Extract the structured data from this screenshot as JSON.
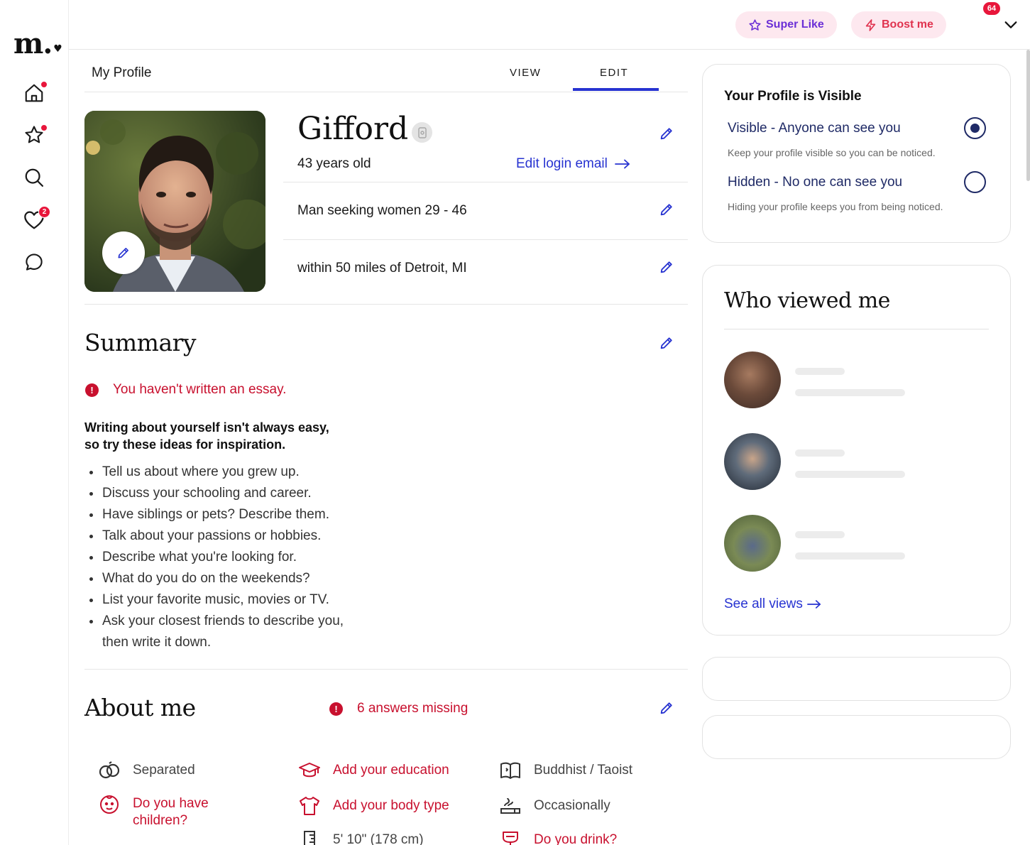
{
  "brand": {
    "logo_text": "m.",
    "logo_heart": "♥"
  },
  "sidebar": {
    "items": [
      {
        "name": "home",
        "icon": "home-icon",
        "dot": true
      },
      {
        "name": "favorites",
        "icon": "star-icon",
        "dot": true
      },
      {
        "name": "search",
        "icon": "search-icon"
      },
      {
        "name": "likes",
        "icon": "heart-icon",
        "badge": "2"
      },
      {
        "name": "messages",
        "icon": "chat-bubble-icon"
      }
    ]
  },
  "topbar": {
    "super_like_label": "Super Like",
    "boost_label": "Boost me",
    "notification_count": "64"
  },
  "profile_header": {
    "title": "My Profile",
    "tabs": [
      {
        "label": "VIEW"
      },
      {
        "label": "EDIT",
        "active": true
      }
    ]
  },
  "profile": {
    "name": "Gifford",
    "age_text": "43 years old",
    "edit_login_email": "Edit login email",
    "seeking": "Man seeking women 29 - 46",
    "location": "within 50 miles of Detroit, MI"
  },
  "summary": {
    "title": "Summary",
    "warning": "You haven't written an essay.",
    "ideas_heading_line1": "Writing about yourself isn't always easy,",
    "ideas_heading_line2": "so try these ideas for inspiration.",
    "ideas": [
      "Tell us about where you grew up.",
      "Discuss your schooling and career.",
      "Have siblings or pets? Describe them.",
      "Talk about your passions or hobbies.",
      "Describe what you're looking for.",
      "What do you do on the weekends?",
      "List your favorite music, movies or TV.",
      "Ask your closest friends to describe you, then write it down."
    ]
  },
  "about": {
    "title": "About me",
    "missing": "6 answers missing",
    "items": [
      {
        "text": "Separated",
        "icon": "rings-icon",
        "missing": false
      },
      {
        "text": "Add your education",
        "icon": "graduation-cap-icon",
        "missing": true
      },
      {
        "text": "Buddhist / Taoist",
        "icon": "book-icon",
        "missing": false
      },
      {
        "text": "Do you have children?",
        "icon": "child-face-icon",
        "missing": true
      },
      {
        "text": "Add your body type",
        "icon": "shirt-icon",
        "missing": true
      },
      {
        "text": "Occasionally",
        "icon": "smoking-icon",
        "missing": false
      },
      {
        "text": "5' 10\" (178 cm)",
        "icon": "ruler-icon",
        "missing": false
      },
      {
        "text": "Do you drink?",
        "icon": "drink-icon",
        "missing": true
      }
    ]
  },
  "visibility": {
    "title": "Your Profile is Visible",
    "options": [
      {
        "label": "Visible - Anyone can see you",
        "desc": "Keep your profile visible so you can be noticed.",
        "selected": true
      },
      {
        "label": "Hidden - No one can see you",
        "desc": "Hiding your profile keeps you from being noticed.",
        "selected": false
      }
    ]
  },
  "who_viewed": {
    "title": "Who viewed me",
    "see_all": "See all views"
  },
  "colors": {
    "accent_blue": "#2733d1",
    "warning_red": "#c8102e",
    "badge_red": "#e8163b",
    "pill_bg": "#fde8ef",
    "navy": "#1f2a66"
  }
}
